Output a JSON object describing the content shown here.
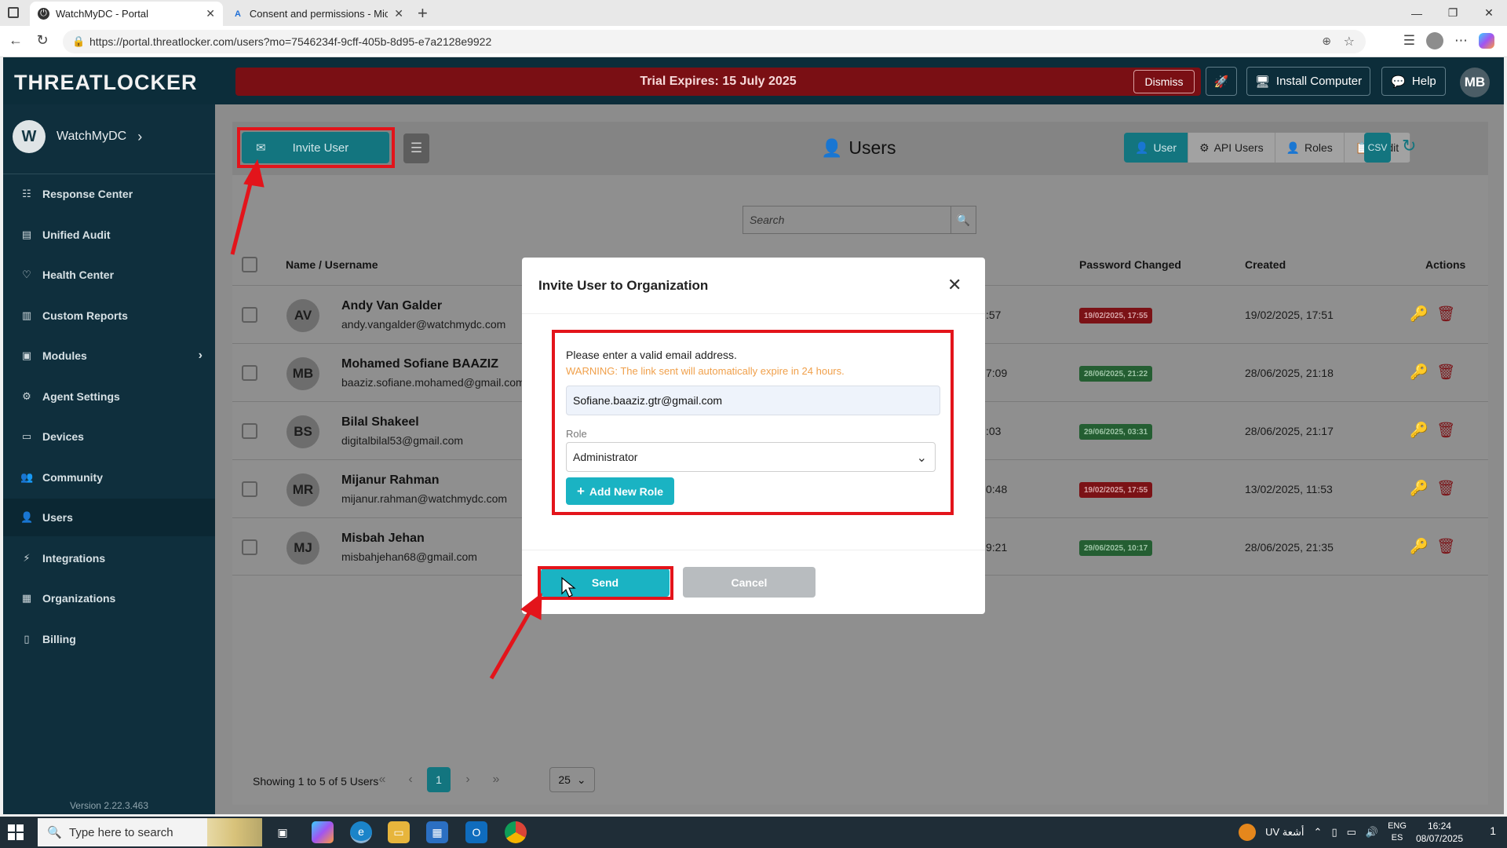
{
  "browser": {
    "tabs": [
      {
        "title": "WatchMyDC - Portal",
        "active": true
      },
      {
        "title": "Consent and permissions - Micro",
        "active": false
      }
    ],
    "url": "https://portal.threatlocker.com/users?mo=7546234f-9cff-405b-8d95-e7a2128e9922"
  },
  "header": {
    "brand": "THREATLOCKER",
    "trial_text": "Trial Expires: 15 July 2025",
    "dismiss_label": "Dismiss",
    "install_label": "Install Computer",
    "help_label": "Help",
    "user_initials": "MB"
  },
  "sidebar": {
    "org_initial": "W",
    "org_name": "WatchMyDC",
    "items": [
      {
        "label": "Response Center",
        "icon": "list-icon"
      },
      {
        "label": "Unified Audit",
        "icon": "document-icon"
      },
      {
        "label": "Health Center",
        "icon": "heart-icon"
      },
      {
        "label": "Custom Reports",
        "icon": "bar-chart-icon"
      },
      {
        "label": "Modules",
        "icon": "module-icon"
      },
      {
        "label": "Agent Settings",
        "icon": "agent-icon"
      },
      {
        "label": "Devices",
        "icon": "monitor-icon"
      },
      {
        "label": "Community",
        "icon": "people-icon"
      },
      {
        "label": "Users",
        "icon": "user-icon"
      },
      {
        "label": "Integrations",
        "icon": "plug-icon"
      },
      {
        "label": "Organizations",
        "icon": "building-icon"
      },
      {
        "label": "Billing",
        "icon": "receipt-icon"
      }
    ],
    "active_item": "Users",
    "version": "Version 2.22.3.463"
  },
  "toolbar": {
    "invite_label": "Invite User",
    "page_title": "Users",
    "segments": [
      "User",
      "API Users",
      "Roles",
      "Audit"
    ],
    "active_segment": "User",
    "search_placeholder": "Search"
  },
  "table": {
    "columns": {
      "name": "Name / Username",
      "password_changed": "Password Changed",
      "created": "Created",
      "actions": "Actions"
    },
    "rows": [
      {
        "initials": "AV",
        "name": "Andy Van Galder",
        "email": "andy.vangalder@watchmydc.com",
        "partial": ":57",
        "password_changed": "19/02/2025, 17:55",
        "badge": "red",
        "created": "19/02/2025, 17:51"
      },
      {
        "initials": "MB",
        "name": "Mohamed Sofiane BAAZIZ",
        "email": "baaziz.sofiane.mohamed@gmail.com",
        "partial": "7:09",
        "password_changed": "28/06/2025, 21:22",
        "badge": "green",
        "created": "28/06/2025, 21:18"
      },
      {
        "initials": "BS",
        "name": "Bilal  Shakeel",
        "email": "digitalbilal53@gmail.com",
        "partial": ":03",
        "password_changed": "29/06/2025, 03:31",
        "badge": "green",
        "created": "28/06/2025, 21:17"
      },
      {
        "initials": "MR",
        "name": "Mijanur Rahman",
        "email": "mijanur.rahman@watchmydc.com",
        "partial": "0:48",
        "password_changed": "19/02/2025, 17:55",
        "badge": "red",
        "created": "13/02/2025, 11:53"
      },
      {
        "initials": "MJ",
        "name": "Misbah Jehan",
        "email": "misbahjehan68@gmail.com",
        "partial": "9:21",
        "password_changed": "29/06/2025, 10:17",
        "badge": "green",
        "created": "28/06/2025, 21:35"
      }
    ]
  },
  "pagination": {
    "info": "Showing 1 to 5 of 5 Users",
    "current_page": "1",
    "page_size": "25"
  },
  "modal": {
    "title": "Invite User to Organization",
    "hint": "Please enter a valid email address.",
    "warning": "WARNING: The link sent will automatically expire in 24 hours.",
    "email_value": "Sofiane.baaziz.gtr@gmail.com",
    "role_label": "Role",
    "role_value": "Administrator",
    "add_role_label": "Add New Role",
    "send_label": "Send",
    "cancel_label": "Cancel"
  },
  "taskbar": {
    "search_placeholder": "Type here to search",
    "weather": "UV أشعة",
    "lang_line1": "ENG",
    "lang_line2": "ES",
    "time": "16:24",
    "date": "08/07/2025",
    "notification_count": "1"
  },
  "colors": {
    "brand_teal": "#13757f",
    "modal_accent": "#1ab3c3",
    "annotation_red": "#e3141b",
    "sidebar_bg": "#0f2f3d"
  }
}
